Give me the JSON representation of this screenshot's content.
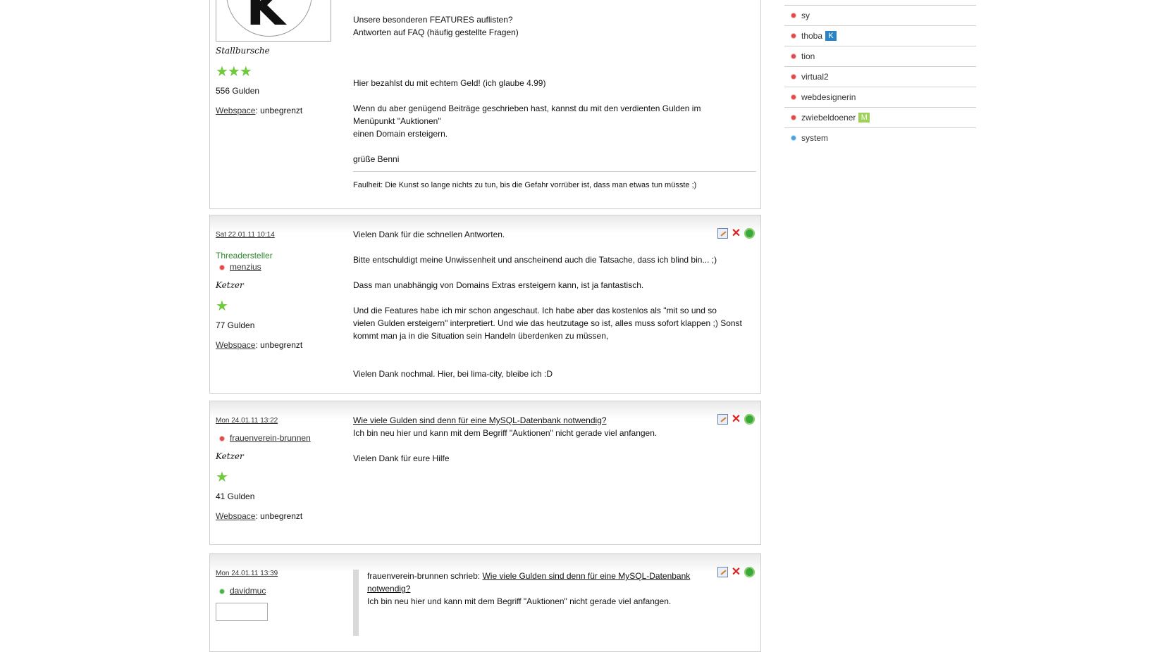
{
  "post1": {
    "rank": "Stallbursche",
    "stars": "★★★",
    "gulden": "556 Gulden",
    "webspace_label": "Webspace",
    "webspace_value": ": unbegrenzt",
    "lines": [
      "Unsere besonderen FEATURES auflisten?",
      "Antworten auf FAQ (häufig gestellte Fragen)",
      "Hier bezahlst du mit echtem Geld! (ich glaube 4.99)",
      "Wenn du aber genügend Beiträge geschrieben hast, kannst du mit den verdienten Gulden im",
      "Menüpunkt \"Auktionen\"",
      "einen Domain ersteigern.",
      "grüße Benni"
    ],
    "signature": "Faulheit: Die Kunst so lange nichts zu tun, bis die Gefahr vorrüber ist, dass man etwas tun müsste ;)"
  },
  "post2": {
    "date": "Sat 22.01.11 10:14",
    "op_label": "Threadersteller",
    "username": "menzius",
    "rank": "Ketzer",
    "stars": "★",
    "gulden": "77 Gulden",
    "webspace_label": "Webspace",
    "webspace_value": ": unbegrenzt",
    "lines": [
      "Vielen Dank für die schnellen Antworten.",
      "Bitte entschuldigt meine Unwissenheit und anscheinend auch die Tatsache, dass ich blind bin... ;)",
      "Dass man unabhängig von Domains Extras ersteigern kann, ist ja fantastisch.",
      "Und die Features habe ich mir schon angeschaut. Ich habe aber das kostenlos als \"mit so und so",
      "vielen Gulden ersteigern\" interpretiert. Und wie das heutzutage so ist, alles muss sofort klappen ;) Sonst",
      "kommt man ja in die Situation sein Handeln überdenken zu müssen,",
      "Vielen Dank nochmal. Hier, bei lima-city, bleibe ich :D"
    ]
  },
  "post3": {
    "date": "Mon 24.01.11 13:22",
    "username": "frauenverein-brunnen",
    "rank": "Ketzer",
    "stars": "★",
    "gulden": "41 Gulden",
    "webspace_label": "Webspace",
    "webspace_value": ": unbegrenzt",
    "title": "Wie viele Gulden sind denn für eine MySQL-Datenbank notwendig?",
    "lines": [
      "Ich bin neu hier und kann mit dem Begriff \"Auktionen\" nicht gerade viel anfangen.",
      "Vielen Dank für eure Hilfe"
    ]
  },
  "post4": {
    "date": "Mon 24.01.11 13:39",
    "username": "davidmuc",
    "quote_author": "frauenverein-brunnen schrieb:",
    "quote_link_1": "Wie viele Gulden sind denn für eine MySQL-Datenbank",
    "quote_link_2": "notwendig?",
    "quote_text": "Ich bin neu hier und kann mit dem Begriff \"Auktionen\" nicht gerade viel anfangen."
  },
  "users": [
    {
      "name": "sy",
      "status": "red",
      "badge": ""
    },
    {
      "name": "thoba",
      "status": "red",
      "badge": "K"
    },
    {
      "name": "tion",
      "status": "red",
      "badge": ""
    },
    {
      "name": "virtual2",
      "status": "red",
      "badge": ""
    },
    {
      "name": "webdesignerin",
      "status": "red",
      "badge": ""
    },
    {
      "name": "zwiebeldoener",
      "status": "red",
      "badge": "M"
    },
    {
      "name": "system",
      "status": "blue",
      "badge": ""
    }
  ]
}
